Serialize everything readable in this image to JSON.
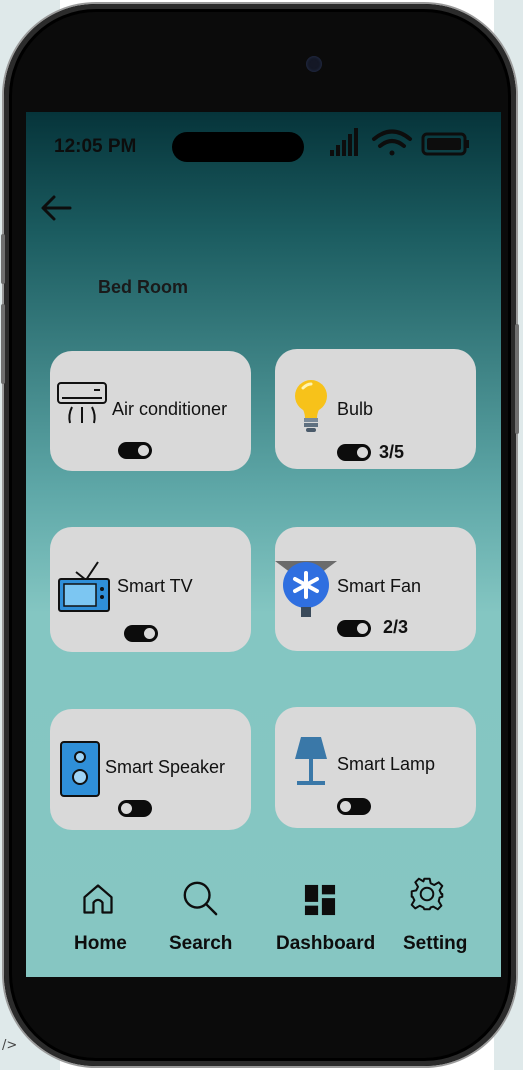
{
  "status_bar": {
    "time": "12:05 PM"
  },
  "header": {
    "room_title": "Bed Room"
  },
  "devices": [
    {
      "label": "Air conditioner",
      "icon": "air-conditioner-icon",
      "on": true,
      "count": ""
    },
    {
      "label": "Bulb",
      "icon": "lightbulb-icon",
      "on": true,
      "count": "3/5"
    },
    {
      "label": "Smart TV",
      "icon": "tv-icon",
      "on": true,
      "count": ""
    },
    {
      "label": "Smart Fan",
      "icon": "fan-icon",
      "on": true,
      "count": "2/3"
    },
    {
      "label": "Smart Speaker",
      "icon": "speaker-icon",
      "on": false,
      "count": ""
    },
    {
      "label": "Smart Lamp",
      "icon": "lamp-icon",
      "on": false,
      "count": ""
    }
  ],
  "bottom_nav": [
    {
      "label": "Home",
      "icon": "home-icon"
    },
    {
      "label": "Search",
      "icon": "search-icon"
    },
    {
      "label": "Dashboard",
      "icon": "dashboard-icon"
    },
    {
      "label": "Setting",
      "icon": "gear-icon"
    }
  ],
  "colors": {
    "card": "#d9d9d9",
    "tv_blue": "#2f8fd8",
    "fan_blue": "#2f6fe0",
    "lamp_blue": "#3a78a8"
  }
}
